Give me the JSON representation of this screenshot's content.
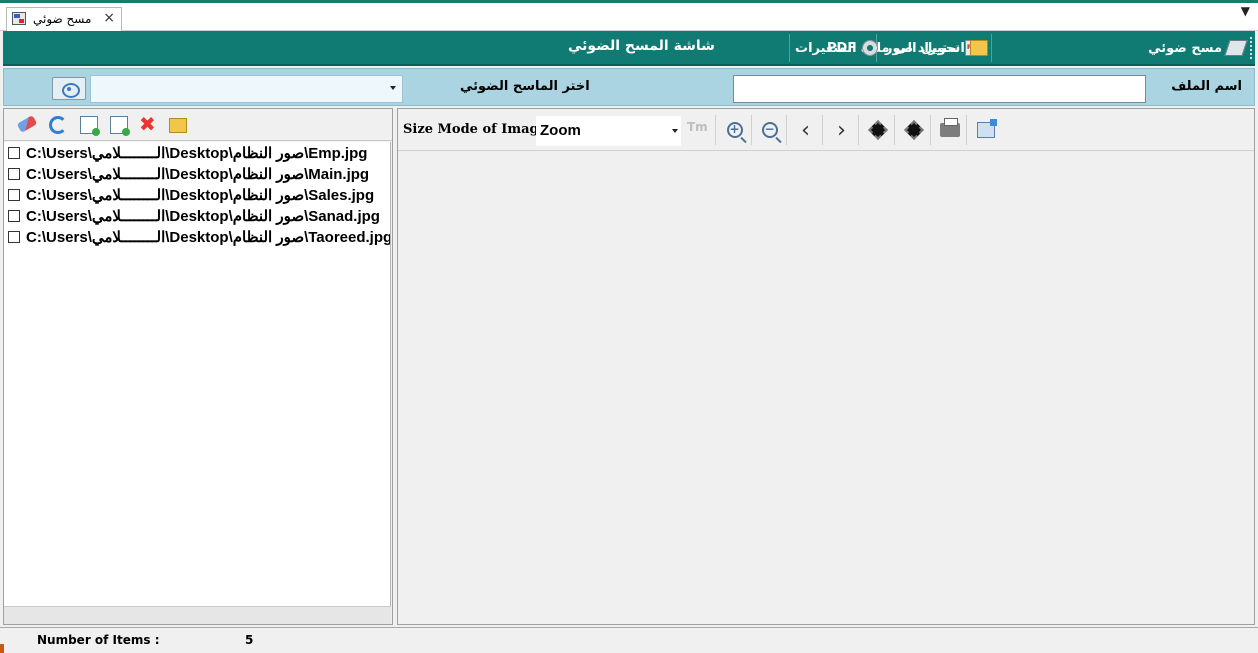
{
  "tab": {
    "title": "مسح ضوئي",
    "close": "×"
  },
  "toolbar": {
    "scan_label": "مسح ضوئي",
    "pdf_label": "تحويل الى ملف PDF",
    "import_label": "استيراد صور",
    "variables_label": "المتغيرات",
    "screen_title": "شاشة المسح الضوئي"
  },
  "params": {
    "filename_label": "اسم الملف",
    "filename_value": "",
    "scanner_label": "اختر الماسح الضوئي",
    "scanner_value": ""
  },
  "files": [
    {
      "path": "C:\\Users\\الــــــــلامي\\Desktop\\صور النظام\\Emp.jpg",
      "checked": false
    },
    {
      "path": "C:\\Users\\الــــــــلامي\\Desktop\\صور النظام\\Main.jpg",
      "checked": false
    },
    {
      "path": "C:\\Users\\الــــــــلامي\\Desktop\\صور النظام\\Sales.jpg",
      "checked": false
    },
    {
      "path": "C:\\Users\\الــــــــلامي\\Desktop\\صور النظام\\Sanad.jpg",
      "checked": false
    },
    {
      "path": "C:\\Users\\الــــــــلامي\\Desktop\\صور النظام\\Taoreed.jpg",
      "checked": false
    }
  ],
  "viewer": {
    "size_mode_label": "Size Mode of Image:",
    "size_mode_value": "Zoom",
    "tm_label": "Tm"
  },
  "status": {
    "items_label": "Number of Items :",
    "items_count": "5"
  },
  "colors": {
    "toolbar_bg": "#0f7b72",
    "param_bg": "#aad4e2"
  }
}
